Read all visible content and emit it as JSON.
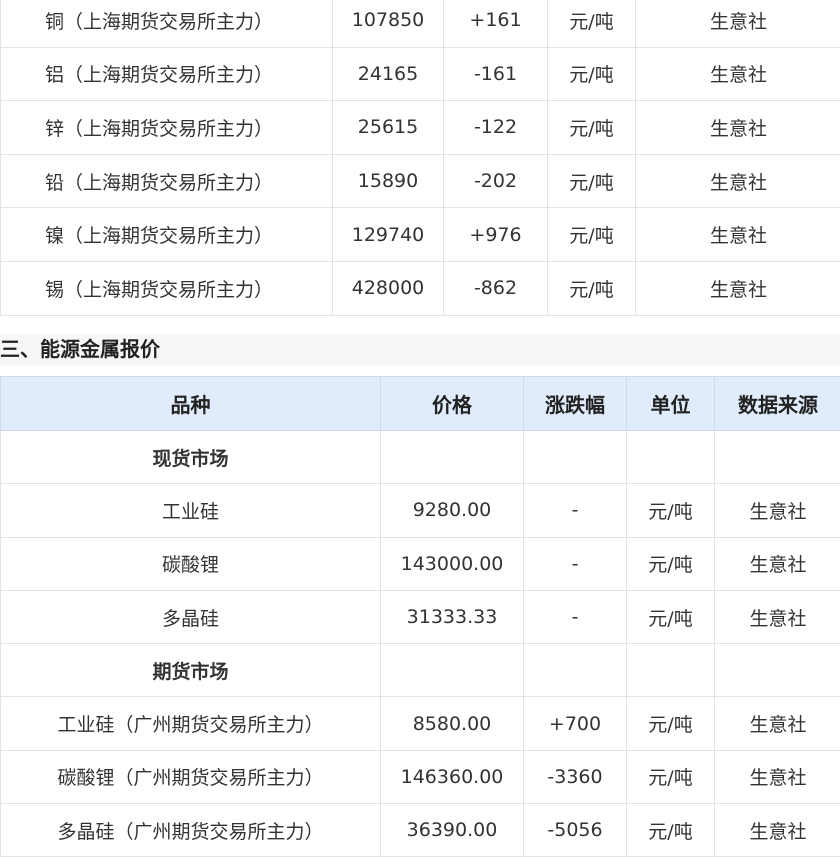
{
  "nonferrous_rows": [
    {
      "name": "铜（上海期货交易所主力）",
      "price": "107850",
      "change": "+161",
      "unit": "元/吨",
      "source": "生意社"
    },
    {
      "name": "铝（上海期货交易所主力）",
      "price": "24165",
      "change": "-161",
      "unit": "元/吨",
      "source": "生意社"
    },
    {
      "name": "锌（上海期货交易所主力）",
      "price": "25615",
      "change": "-122",
      "unit": "元/吨",
      "source": "生意社"
    },
    {
      "name": "铅（上海期货交易所主力）",
      "price": "15890",
      "change": "-202",
      "unit": "元/吨",
      "source": "生意社"
    },
    {
      "name": "镍（上海期货交易所主力）",
      "price": "129740",
      "change": "+976",
      "unit": "元/吨",
      "source": "生意社"
    },
    {
      "name": "锡（上海期货交易所主力）",
      "price": "428000",
      "change": "-862",
      "unit": "元/吨",
      "source": "生意社"
    }
  ],
  "section3_title": "三、能源金属报价",
  "energy_table": {
    "headers": {
      "variety": "品种",
      "price": "价格",
      "change": "涨跌幅",
      "unit": "单位",
      "source": "数据来源"
    },
    "spot_label": "现货市场",
    "spot_rows": [
      {
        "name": "工业硅",
        "price": "9280.00",
        "change": "-",
        "unit": "元/吨",
        "source": "生意社"
      },
      {
        "name": "碳酸锂",
        "price": "143000.00",
        "change": "-",
        "unit": "元/吨",
        "source": "生意社"
      },
      {
        "name": "多晶硅",
        "price": "31333.33",
        "change": "-",
        "unit": "元/吨",
        "source": "生意社"
      }
    ],
    "futures_label": "期货市场",
    "futures_rows": [
      {
        "name": "工业硅（广州期货交易所主力）",
        "price": "8580.00",
        "change": "+700",
        "unit": "元/吨",
        "source": "生意社"
      },
      {
        "name": "碳酸锂（广州期货交易所主力）",
        "price": "146360.00",
        "change": "-3360",
        "unit": "元/吨",
        "source": "生意社"
      },
      {
        "name": "多晶硅（广州期货交易所主力）",
        "price": "36390.00",
        "change": "-5056",
        "unit": "元/吨",
        "source": "生意社"
      }
    ]
  }
}
